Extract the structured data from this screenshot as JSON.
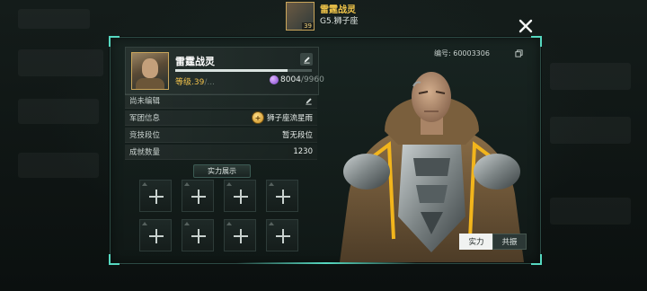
{
  "header": {
    "player_name": "雷霆战灵",
    "player_sub": "G5.狮子座",
    "avatar_level": "39"
  },
  "profile": {
    "name": "雷霆战灵",
    "level_label": "等级.39",
    "level_suffix": "/...",
    "xp_fraction": 0.82,
    "currency_current": "8004",
    "currency_max": "/9960",
    "currency_icon": "purple-orb-icon"
  },
  "info_rows": [
    {
      "label": "尚未编辑",
      "value": ""
    },
    {
      "label": "军团信息",
      "value": "狮子座流星雨"
    },
    {
      "label": "竞技段位",
      "value": "暂无段位"
    },
    {
      "label": "成就数量",
      "value": "1230"
    }
  ],
  "power_section": {
    "title": "实力展示",
    "slot_count": 8
  },
  "character": {
    "id_label": "编号: 60003306"
  },
  "tabs": {
    "strength": "实力",
    "resonance": "共振"
  },
  "colors": {
    "accent": "#56d8c0",
    "gold": "#f2c24b",
    "panel": "#182421"
  }
}
